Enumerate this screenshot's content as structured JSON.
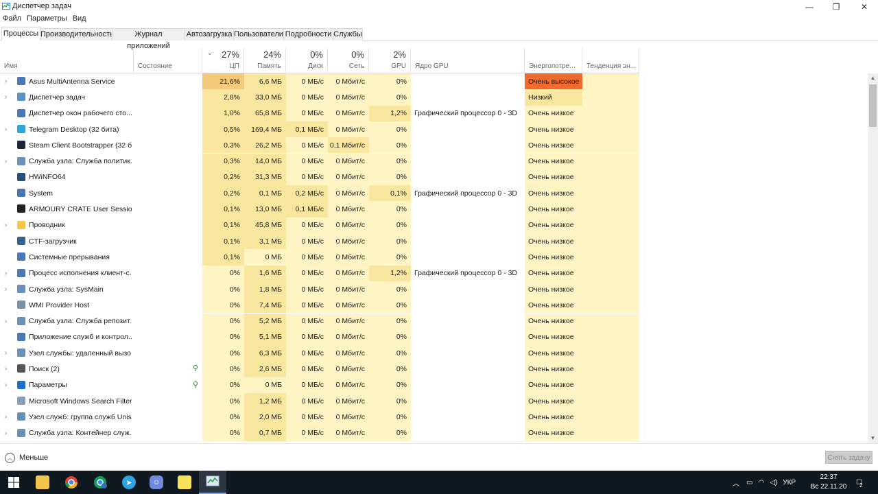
{
  "window": {
    "title": "Диспетчер задач",
    "minimize": "—",
    "restore": "❐",
    "close": "✕"
  },
  "menu": [
    "Файл",
    "Параметры",
    "Вид"
  ],
  "tabs": [
    "Процессы",
    "Производительность",
    "Журнал приложений",
    "Автозагрузка",
    "Пользователи",
    "Подробности",
    "Службы"
  ],
  "columns": {
    "name": "Имя",
    "status": "Состояние",
    "cpu": {
      "pct": "27%",
      "label": "ЦП"
    },
    "mem": {
      "pct": "24%",
      "label": "Память"
    },
    "disk": {
      "pct": "0%",
      "label": "Диск"
    },
    "net": {
      "pct": "0%",
      "label": "Сеть"
    },
    "gpu": {
      "pct": "2%",
      "label": "GPU"
    },
    "gpu_engine": "Ядро GPU",
    "power": "Энергопотре...",
    "power_trend": "Тенденция эн..."
  },
  "processes": [
    {
      "name": "Asus MultiAntenna Service",
      "expandable": true,
      "icon": "service-icon",
      "cpu": "21,6%",
      "mem": "6,6 МБ",
      "disk": "0 МБ/с",
      "net": "0 Мбит/с",
      "gpu": "0%",
      "gpu_engine": "",
      "power": "Очень высокое",
      "power_level": "very-high",
      "suspended_leaf": false
    },
    {
      "name": "Диспетчер задач",
      "expandable": true,
      "icon": "taskmgr-icon",
      "cpu": "2,8%",
      "mem": "33,0 МБ",
      "disk": "0 МБ/с",
      "net": "0 Мбит/с",
      "gpu": "0%",
      "gpu_engine": "",
      "power": "Низкий",
      "power_level": "low",
      "suspended_leaf": false
    },
    {
      "name": "Диспетчер окон рабочего сто...",
      "expandable": false,
      "icon": "service-icon",
      "cpu": "1,0%",
      "mem": "65,8 МБ",
      "disk": "0 МБ/с",
      "net": "0 Мбит/с",
      "gpu": "1,2%",
      "gpu_engine": "Графический процессор 0 - 3D",
      "power": "Очень низкое",
      "power_level": "very-low",
      "suspended_leaf": false
    },
    {
      "name": "Telegram Desktop (32 бита)",
      "expandable": true,
      "icon": "telegram-icon",
      "cpu": "0,5%",
      "mem": "169,4 МБ",
      "disk": "0,1 МБ/с",
      "net": "0 Мбит/с",
      "gpu": "0%",
      "gpu_engine": "",
      "power": "Очень низкое",
      "power_level": "very-low",
      "suspended_leaf": false
    },
    {
      "name": "Steam Client Bootstrapper (32 б...",
      "expandable": false,
      "icon": "steam-icon",
      "cpu": "0,3%",
      "mem": "26,2 МБ",
      "disk": "0 МБ/с",
      "net": "0,1 Мбит/с",
      "gpu": "0%",
      "gpu_engine": "",
      "power": "Очень низкое",
      "power_level": "very-low",
      "suspended_leaf": false
    },
    {
      "name": "Служба узла: Служба политик...",
      "expandable": true,
      "icon": "gear-icon",
      "cpu": "0,3%",
      "mem": "14,0 МБ",
      "disk": "0 МБ/с",
      "net": "0 Мбит/с",
      "gpu": "0%",
      "gpu_engine": "",
      "power": "Очень низкое",
      "power_level": "very-low",
      "suspended_leaf": false
    },
    {
      "name": "HWiNFO64",
      "expandable": false,
      "icon": "chip-icon",
      "cpu": "0,2%",
      "mem": "31,3 МБ",
      "disk": "0 МБ/с",
      "net": "0 Мбит/с",
      "gpu": "0%",
      "gpu_engine": "",
      "power": "Очень низкое",
      "power_level": "very-low",
      "suspended_leaf": false
    },
    {
      "name": "System",
      "expandable": false,
      "icon": "service-icon",
      "cpu": "0,2%",
      "mem": "0,1 МБ",
      "disk": "0,2 МБ/с",
      "net": "0 Мбит/с",
      "gpu": "0,1%",
      "gpu_engine": "Графический процессор 0 - 3D",
      "power": "Очень низкое",
      "power_level": "very-low",
      "suspended_leaf": false
    },
    {
      "name": "ARMOURY CRATE User Session ...",
      "expandable": false,
      "icon": "armoury-icon",
      "cpu": "0,1%",
      "mem": "13,0 МБ",
      "disk": "0,1 МБ/с",
      "net": "0 Мбит/с",
      "gpu": "0%",
      "gpu_engine": "",
      "power": "Очень низкое",
      "power_level": "very-low",
      "suspended_leaf": false
    },
    {
      "name": "Проводник",
      "expandable": true,
      "icon": "folder-icon",
      "cpu": "0,1%",
      "mem": "45,8 МБ",
      "disk": "0 МБ/с",
      "net": "0 Мбит/с",
      "gpu": "0%",
      "gpu_engine": "",
      "power": "Очень низкое",
      "power_level": "very-low",
      "suspended_leaf": false
    },
    {
      "name": "CTF-загрузчик",
      "expandable": false,
      "icon": "pen-icon",
      "cpu": "0,1%",
      "mem": "3,1 МБ",
      "disk": "0 МБ/с",
      "net": "0 Мбит/с",
      "gpu": "0%",
      "gpu_engine": "",
      "power": "Очень низкое",
      "power_level": "very-low",
      "suspended_leaf": false
    },
    {
      "name": "Системные прерывания",
      "expandable": false,
      "icon": "service-icon",
      "cpu": "0,1%",
      "mem": "0 МБ",
      "disk": "0 МБ/с",
      "net": "0 Мбит/с",
      "gpu": "0%",
      "gpu_engine": "",
      "power": "Очень низкое",
      "power_level": "very-low",
      "suspended_leaf": false
    },
    {
      "name": "Процесс исполнения клиент-с...",
      "expandable": true,
      "icon": "service-icon",
      "cpu": "0%",
      "mem": "1,6 МБ",
      "disk": "0 МБ/с",
      "net": "0 Мбит/с",
      "gpu": "1,2%",
      "gpu_engine": "Графический процессор 0 - 3D",
      "power": "Очень низкое",
      "power_level": "very-low",
      "suspended_leaf": false
    },
    {
      "name": "Служба узла: SysMain",
      "expandable": true,
      "icon": "gear-icon",
      "cpu": "0%",
      "mem": "1,8 МБ",
      "disk": "0 МБ/с",
      "net": "0 Мбит/с",
      "gpu": "0%",
      "gpu_engine": "",
      "power": "Очень низкое",
      "power_level": "very-low",
      "suspended_leaf": false
    },
    {
      "name": "WMI Provider Host",
      "expandable": false,
      "icon": "wmi-icon",
      "cpu": "0%",
      "mem": "7,4 МБ",
      "disk": "0 МБ/с",
      "net": "0 Мбит/с",
      "gpu": "0%",
      "gpu_engine": "",
      "power": "Очень низкое",
      "power_level": "very-low",
      "suspended_leaf": false
    },
    {
      "name": "Служба узла: Служба репозит...",
      "expandable": true,
      "icon": "gear-icon",
      "cpu": "0%",
      "mem": "5,2 МБ",
      "disk": "0 МБ/с",
      "net": "0 Мбит/с",
      "gpu": "0%",
      "gpu_engine": "",
      "power": "Очень низкое",
      "power_level": "very-low",
      "suspended_leaf": false
    },
    {
      "name": "Приложение служб и контрол...",
      "expandable": false,
      "icon": "service-icon",
      "cpu": "0%",
      "mem": "5,1 МБ",
      "disk": "0 МБ/с",
      "net": "0 Мбит/с",
      "gpu": "0%",
      "gpu_engine": "",
      "power": "Очень низкое",
      "power_level": "very-low",
      "suspended_leaf": false
    },
    {
      "name": "Узел службы: удаленный вызо...",
      "expandable": true,
      "icon": "gear-icon",
      "cpu": "0%",
      "mem": "6,3 МБ",
      "disk": "0 МБ/с",
      "net": "0 Мбит/с",
      "gpu": "0%",
      "gpu_engine": "",
      "power": "Очень низкое",
      "power_level": "very-low",
      "suspended_leaf": false
    },
    {
      "name": "Поиск (2)",
      "expandable": true,
      "icon": "search-app-icon",
      "cpu": "0%",
      "mem": "2,6 МБ",
      "disk": "0 МБ/с",
      "net": "0 Мбит/с",
      "gpu": "0%",
      "gpu_engine": "",
      "power": "Очень низкое",
      "power_level": "very-low",
      "suspended_leaf": true
    },
    {
      "name": "Параметры",
      "expandable": true,
      "icon": "settings-app-icon",
      "cpu": "0%",
      "mem": "0 МБ",
      "disk": "0 МБ/с",
      "net": "0 Мбит/с",
      "gpu": "0%",
      "gpu_engine": "",
      "power": "Очень низкое",
      "power_level": "very-low",
      "suspended_leaf": true
    },
    {
      "name": "Microsoft Windows Search Filter...",
      "expandable": false,
      "icon": "search-filter-icon",
      "cpu": "0%",
      "mem": "1,2 МБ",
      "disk": "0 МБ/с",
      "net": "0 Мбит/с",
      "gpu": "0%",
      "gpu_engine": "",
      "power": "Очень низкое",
      "power_level": "very-low",
      "suspended_leaf": false
    },
    {
      "name": "Узел служб: группа служб Unis...",
      "expandable": true,
      "icon": "gear-icon",
      "cpu": "0%",
      "mem": "2,0 МБ",
      "disk": "0 МБ/с",
      "net": "0 Мбит/с",
      "gpu": "0%",
      "gpu_engine": "",
      "power": "Очень низкое",
      "power_level": "very-low",
      "suspended_leaf": false
    },
    {
      "name": "Служба узла: Контейнер служ...",
      "expandable": true,
      "icon": "gear-icon",
      "cpu": "0%",
      "mem": "0,7 МБ",
      "disk": "0 МБ/с",
      "net": "0 Мбит/с",
      "gpu": "0%",
      "gpu_engine": "",
      "power": "Очень низкое",
      "power_level": "very-low",
      "suspended_leaf": false
    }
  ],
  "colors": {
    "heat_low": "#fff4c4",
    "heat_mid": "#f9e7a0",
    "heat_high": "#f4c97a",
    "power_very_high": "#f26a2e",
    "power_low": "#f9e7a0",
    "power_col": "#fff4c4"
  },
  "footer": {
    "less_label": "Меньше",
    "end_task_label": "Снять задачу"
  },
  "taskbar": {
    "apps": [
      "windows-start-icon",
      "file-explorer-icon",
      "chrome-icon",
      "chrome-profile-icon",
      "telegram-icon",
      "discord-icon",
      "sticky-notes-icon",
      "task-manager-icon"
    ],
    "lang": "УКР",
    "time": "22:37",
    "date": "Вс 22.11.20",
    "notifications": "2"
  }
}
